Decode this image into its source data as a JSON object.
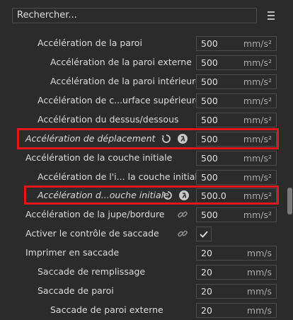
{
  "search": {
    "placeholder": "Rechercher..."
  },
  "menu_icon": "hamburger-menu-icon",
  "colors": {
    "highlight": "#e3141b",
    "background": "#2b2b2b"
  },
  "rows": [
    {
      "label": "Accélération de la paroi",
      "value": "500",
      "unit": "mm/s²"
    },
    {
      "label": "Accélération de la paroi externe",
      "value": "500",
      "unit": "mm/s²"
    },
    {
      "label": "Accélération de la paroi intérieure",
      "value": "500",
      "unit": "mm/s²"
    },
    {
      "label": "Accélération de c...urface supérieure",
      "value": "500",
      "unit": "mm/s²"
    },
    {
      "label": "Accélération du dessus/dessous",
      "value": "500",
      "unit": "mm/s²"
    },
    {
      "label": "Accélération de déplacement",
      "value": "500",
      "unit": "mm/s²"
    },
    {
      "label": "Accélération de la couche initiale",
      "value": "500",
      "unit": "mm/s²"
    },
    {
      "label": "Accélération de l'i... la couche initiale",
      "value": "500",
      "unit": "mm/s²"
    },
    {
      "label": "Accélération d...ouche initiale",
      "value": "500.0",
      "unit": "mm/s²"
    },
    {
      "label": "Accélération de la jupe/bordure",
      "value": "500",
      "unit": "mm/s²"
    },
    {
      "label": "Activer le contrôle de saccade",
      "checked": true
    },
    {
      "label": "Imprimer en saccade",
      "value": "20",
      "unit": "mm/s"
    },
    {
      "label": "Saccade de remplissage",
      "value": "20",
      "unit": "mm/s"
    },
    {
      "label": "Saccade de paroi",
      "value": "20",
      "unit": "mm/s"
    },
    {
      "label": "Saccade de paroi externe",
      "value": "20",
      "unit": "mm/s"
    }
  ]
}
